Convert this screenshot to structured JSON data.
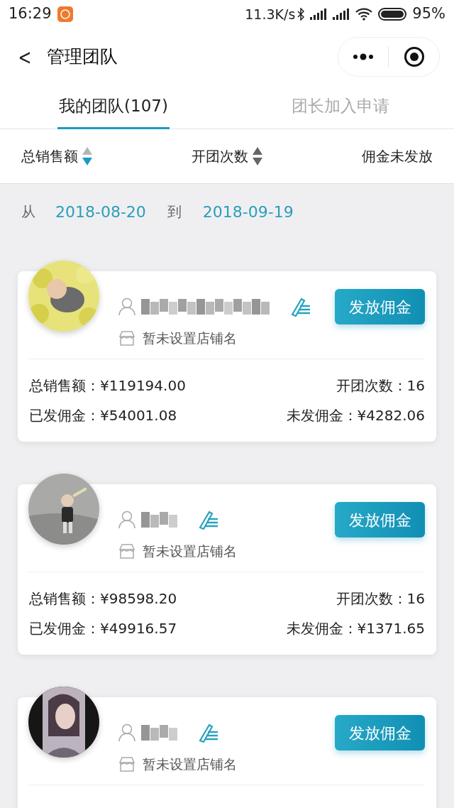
{
  "status_bar": {
    "time": "16:29",
    "speed": "11.3K/s",
    "battery": "95%"
  },
  "nav": {
    "back": "<",
    "title": "管理团队"
  },
  "tabs": [
    {
      "label": "我的团队(107)",
      "selected": true
    },
    {
      "label": "团长加入申请",
      "selected": false
    }
  ],
  "sort_bar": [
    {
      "label": "总销售额",
      "kind": "sortable",
      "selected": true
    },
    {
      "label": "开团次数",
      "kind": "sortable",
      "selected": false
    },
    {
      "label": "佣金未发放",
      "kind": "plain"
    }
  ],
  "date_range": {
    "from_label": "从",
    "from": "2018-08-20",
    "to_label": "到",
    "to": "2018-09-19"
  },
  "members": [
    {
      "shop": "暂未设置店铺名",
      "button": "发放佣金",
      "stats": {
        "total_sales_label": "总销售额：",
        "total_sales": "¥119194.00",
        "groups_label": "开团次数：",
        "groups": "16",
        "paid_label": "已发佣金：",
        "paid": "¥54001.08",
        "unpaid_label": "未发佣金：",
        "unpaid": "¥4282.06"
      }
    },
    {
      "shop": "暂未设置店铺名",
      "button": "发放佣金",
      "stats": {
        "total_sales_label": "总销售额：",
        "total_sales": "¥98598.20",
        "groups_label": "开团次数：",
        "groups": "16",
        "paid_label": "已发佣金：",
        "paid": "¥49916.57",
        "unpaid_label": "未发佣金：",
        "unpaid": "¥1371.65"
      }
    },
    {
      "shop": "暂未设置店铺名",
      "button": "发放佣金"
    }
  ]
}
